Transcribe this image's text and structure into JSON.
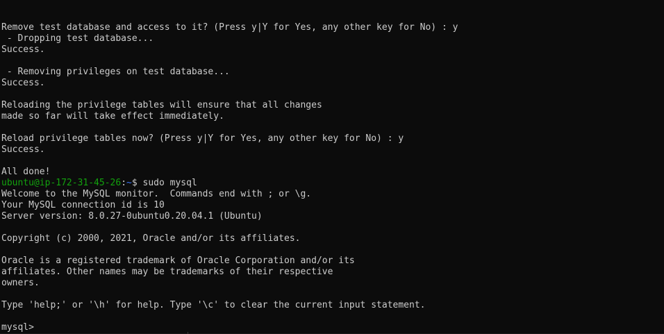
{
  "terminal": {
    "colors": {
      "background": "#0c0c0c",
      "foreground": "#cccccc",
      "prompt_user": "#13a10e",
      "prompt_path": "#3b78ff"
    },
    "lines": [
      "Remove test database and access to it? (Press y|Y for Yes, any other key for No) : y",
      " - Dropping test database...",
      "Success.",
      "",
      " - Removing privileges on test database...",
      "Success.",
      "",
      "Reloading the privilege tables will ensure that all changes",
      "made so far will take effect immediately.",
      "",
      "Reload privilege tables now? (Press y|Y for Yes, any other key for No) : y",
      "Success.",
      "",
      "All done!"
    ],
    "shell_prompt": {
      "user_host": "ubuntu@ip-172-31-45-26",
      "separator": ":",
      "path": "~",
      "symbol": "$ ",
      "command": "sudo mysql"
    },
    "mysql_output": [
      "Welcome to the MySQL monitor.  Commands end with ; or \\g.",
      "Your MySQL connection id is 10",
      "Server version: 8.0.27-0ubuntu0.20.04.1 (Ubuntu)",
      "",
      "Copyright (c) 2000, 2021, Oracle and/or its affiliates.",
      "",
      "Oracle is a registered trademark of Oracle Corporation and/or its",
      "affiliates. Other names may be trademarks of their respective",
      "owners.",
      "",
      "Type 'help;' or '\\h' for help. Type '\\c' to clear the current input statement.",
      ""
    ],
    "mysql_prompt": "mysql> "
  }
}
